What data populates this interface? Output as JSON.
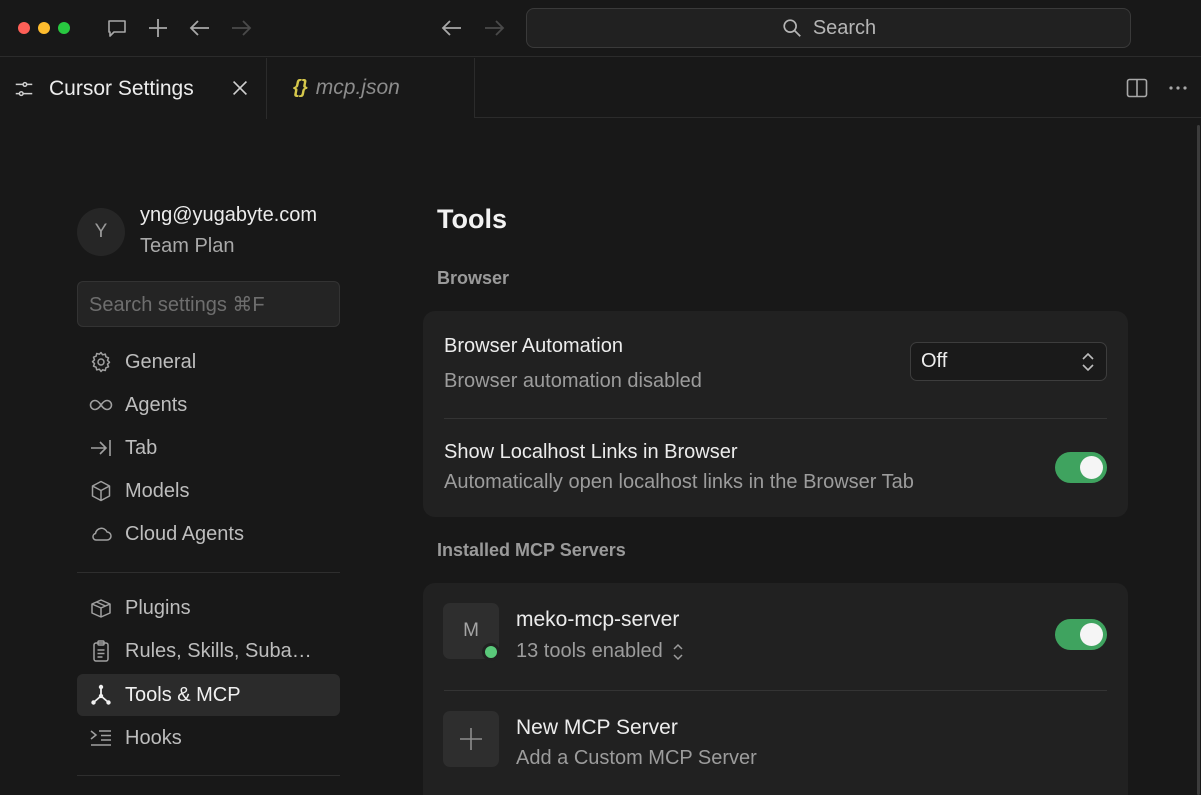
{
  "titlebar": {
    "search_placeholder": "Search"
  },
  "tabs": [
    {
      "label": "Cursor Settings",
      "active": true
    },
    {
      "label": "mcp.json",
      "icon": "{}",
      "active": false
    }
  ],
  "sidebar": {
    "user": {
      "avatar_initial": "Y",
      "email": "yng@yugabyte.com",
      "plan": "Team Plan"
    },
    "search_placeholder": "Search settings ⌘F",
    "items": [
      {
        "label": "General",
        "icon": "gear-icon"
      },
      {
        "label": "Agents",
        "icon": "infinity-icon"
      },
      {
        "label": "Tab",
        "icon": "arrow-right-bar-icon"
      },
      {
        "label": "Models",
        "icon": "cube-icon"
      },
      {
        "label": "Cloud Agents",
        "icon": "cloud-icon"
      },
      {
        "label": "Plugins",
        "icon": "package-icon"
      },
      {
        "label": "Rules, Skills, Subagents",
        "icon": "clipboard-icon"
      },
      {
        "label": "Tools & MCP",
        "icon": "tools-network-icon",
        "active": true
      },
      {
        "label": "Hooks",
        "icon": "hooks-icon"
      }
    ]
  },
  "main": {
    "title": "Tools",
    "browser_section": {
      "label": "Browser",
      "automation": {
        "title": "Browser Automation",
        "subtitle": "Browser automation disabled",
        "select_value": "Off"
      },
      "localhost": {
        "title": "Show Localhost Links in Browser",
        "subtitle": "Automatically open localhost links in the Browser Tab",
        "enabled": true
      }
    },
    "mcp_section": {
      "label": "Installed MCP Servers",
      "servers": [
        {
          "initial": "M",
          "name": "meko-mcp-server",
          "tools": "13 tools enabled",
          "enabled": true,
          "status_color": "#5ac97a"
        }
      ],
      "new_server": {
        "title": "New MCP Server",
        "subtitle": "Add a Custom MCP Server"
      }
    }
  },
  "colors": {
    "background": "#181818",
    "card": "#212121",
    "toggle_on": "#3fa35f",
    "json_icon": "#d6c84b"
  }
}
